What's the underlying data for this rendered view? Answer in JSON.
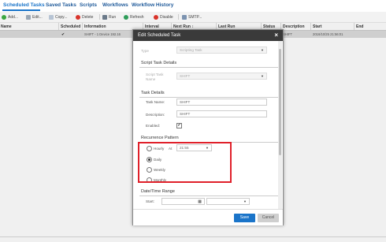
{
  "tabs": [
    "Scheduled Tasks",
    "Saved Tasks",
    "Scripts",
    "Workflows",
    "Workflow History"
  ],
  "toolbar": {
    "add": "Add...",
    "edit": "Edit...",
    "copy": "Copy...",
    "delete": "Delete",
    "run": "Run",
    "refresh": "Refresh",
    "disable": "Disable",
    "smtp": "SMTP..."
  },
  "colors": {
    "accent": "#1a74c9",
    "highlight": "#e0202a",
    "modal_header": "#3a3a3a"
  },
  "grid": {
    "headers": [
      "Name",
      "Scheduled",
      "Information",
      "Interval",
      "Next Run ↕",
      "Last Run",
      "Status",
      "Description",
      "Start",
      "End"
    ],
    "row": {
      "name": "",
      "scheduled": "✔",
      "information": "SHIFT - 1 Device 192.16",
      "status": "",
      "description": "SHIFT",
      "start": "2016/10/25 21:56:01"
    }
  },
  "dialog": {
    "title": "Edit Scheduled Task",
    "close": "×",
    "type_label": "Type",
    "type_value": "Scripting Task",
    "script_section": "Script Task Details",
    "script_task_label": "Script Task Name",
    "script_task_value": "SHIFT",
    "task_section": "Task Details",
    "task_name_label": "Task Name:",
    "task_name_value": "SHIFT",
    "description_label": "Description:",
    "description_value": "SHIFT",
    "enabled_label": "Enabled:",
    "enabled_check": "✔",
    "recurrence_section": "Recurrence Pattern",
    "hourly": "Hourly",
    "at_label": "At",
    "at_value": "21:55",
    "daily": "Daily",
    "weekly": "Weekly",
    "monthly": "Monthly",
    "selected_pattern": "Daily",
    "date_section": "Date/Time Range",
    "start_label": "Start:",
    "save": "Save",
    "cancel": "Cancel"
  }
}
